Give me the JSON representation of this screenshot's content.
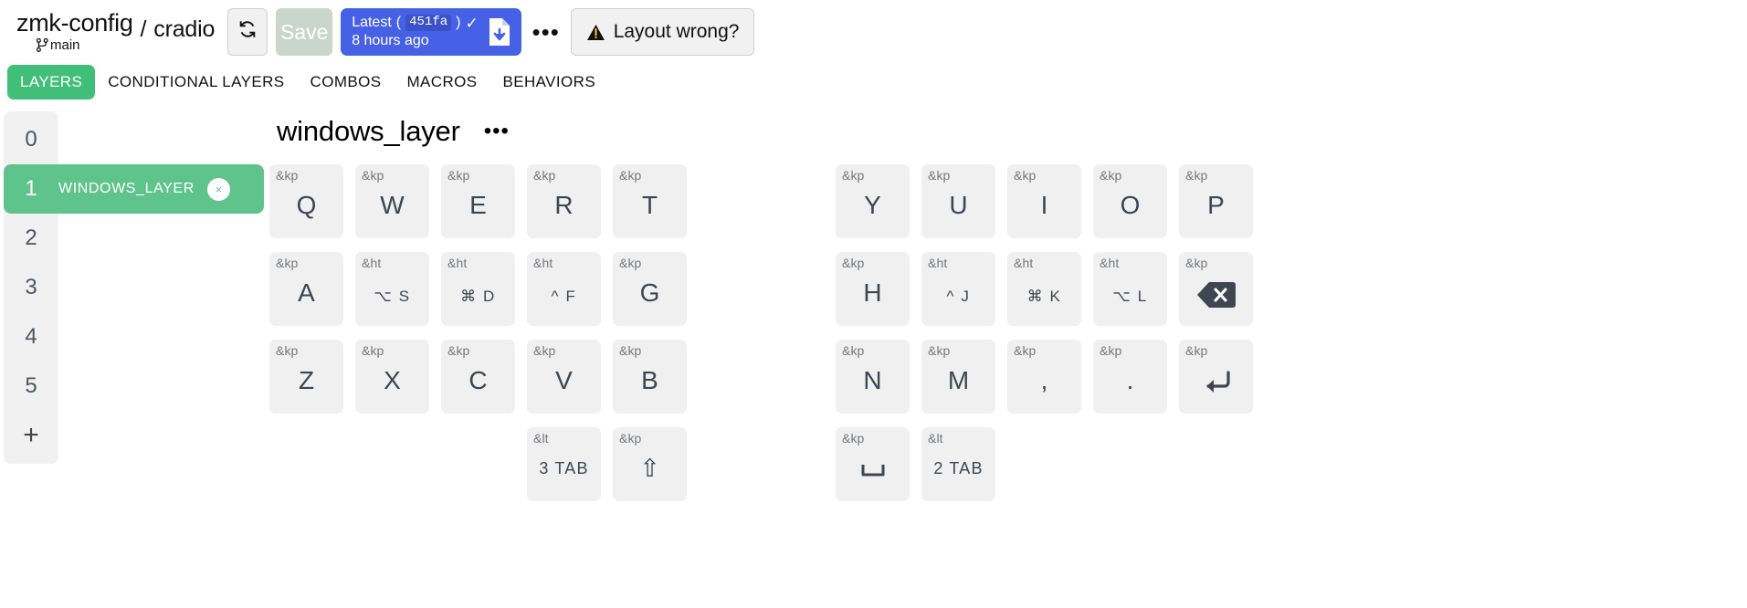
{
  "header": {
    "repo_name": "zmk-config",
    "branch": "main",
    "separator": "/",
    "keyboard": "cradio",
    "refresh_icon": "refresh-icon",
    "save_label": "Save",
    "commit": {
      "label": "Latest",
      "open_paren": "(",
      "sha": "451fa",
      "close_paren": ")",
      "check": "✓",
      "time": "8 hours ago",
      "download_icon": "file-download-icon",
      "color": "#4661e6"
    },
    "more_label": "•••",
    "layout_warning_label": "Layout wrong?",
    "layout_warning_icon": "warning-triangle-icon"
  },
  "tabs": [
    {
      "label": "LAYERS",
      "active": true
    },
    {
      "label": "CONDITIONAL LAYERS",
      "active": false
    },
    {
      "label": "COMBOS",
      "active": false
    },
    {
      "label": "MACROS",
      "active": false
    },
    {
      "label": "BEHAVIORS",
      "active": false
    }
  ],
  "tab_active_color": "#41bf78",
  "layers": {
    "items": [
      {
        "index": "0",
        "name": "",
        "selected": false
      },
      {
        "index": "1",
        "name": "WINDOWS_LAYER",
        "selected": true
      },
      {
        "index": "2",
        "name": "",
        "selected": false
      },
      {
        "index": "3",
        "name": "",
        "selected": false
      },
      {
        "index": "4",
        "name": "",
        "selected": false
      },
      {
        "index": "5",
        "name": "",
        "selected": false
      }
    ],
    "add_label": "+",
    "delete_label": "×",
    "selected_color": "#5ec48c"
  },
  "keymap": {
    "title": "windows_layer",
    "menu_label": "•••",
    "left": [
      {
        "behavior": "&kp",
        "cap": "Q",
        "style": "letter",
        "row": 0,
        "col": 0
      },
      {
        "behavior": "&kp",
        "cap": "W",
        "style": "letter",
        "row": 0,
        "col": 1
      },
      {
        "behavior": "&kp",
        "cap": "E",
        "style": "letter",
        "row": 0,
        "col": 2
      },
      {
        "behavior": "&kp",
        "cap": "R",
        "style": "letter",
        "row": 0,
        "col": 3
      },
      {
        "behavior": "&kp",
        "cap": "T",
        "style": "letter",
        "row": 0,
        "col": 4
      },
      {
        "behavior": "&kp",
        "cap": "A",
        "style": "letter",
        "row": 1,
        "col": 0
      },
      {
        "behavior": "&ht",
        "cap": "⌥ S",
        "style": "mod",
        "row": 1,
        "col": 1
      },
      {
        "behavior": "&ht",
        "cap": "⌘ D",
        "style": "mod",
        "row": 1,
        "col": 2
      },
      {
        "behavior": "&ht",
        "cap": "^ F",
        "style": "mod",
        "row": 1,
        "col": 3
      },
      {
        "behavior": "&kp",
        "cap": "G",
        "style": "letter",
        "row": 1,
        "col": 4
      },
      {
        "behavior": "&kp",
        "cap": "Z",
        "style": "letter",
        "row": 2,
        "col": 0
      },
      {
        "behavior": "&kp",
        "cap": "X",
        "style": "letter",
        "row": 2,
        "col": 1
      },
      {
        "behavior": "&kp",
        "cap": "C",
        "style": "letter",
        "row": 2,
        "col": 2
      },
      {
        "behavior": "&kp",
        "cap": "V",
        "style": "letter",
        "row": 2,
        "col": 3
      },
      {
        "behavior": "&kp",
        "cap": "B",
        "style": "letter",
        "row": 2,
        "col": 4
      },
      {
        "behavior": "&lt",
        "cap": "3 TAB",
        "style": "small",
        "row": 3,
        "col": 3
      },
      {
        "behavior": "&kp",
        "cap": "⇧",
        "style": "glyph",
        "row": 3,
        "col": 4
      }
    ],
    "right": [
      {
        "behavior": "&kp",
        "cap": "Y",
        "style": "letter",
        "row": 0,
        "col": 0
      },
      {
        "behavior": "&kp",
        "cap": "U",
        "style": "letter",
        "row": 0,
        "col": 1
      },
      {
        "behavior": "&kp",
        "cap": "I",
        "style": "letter",
        "row": 0,
        "col": 2
      },
      {
        "behavior": "&kp",
        "cap": "O",
        "style": "letter",
        "row": 0,
        "col": 3
      },
      {
        "behavior": "&kp",
        "cap": "P",
        "style": "letter",
        "row": 0,
        "col": 4
      },
      {
        "behavior": "&kp",
        "cap": "H",
        "style": "letter",
        "row": 1,
        "col": 0
      },
      {
        "behavior": "&ht",
        "cap": "^ J",
        "style": "mod",
        "row": 1,
        "col": 1
      },
      {
        "behavior": "&ht",
        "cap": "⌘ K",
        "style": "mod",
        "row": 1,
        "col": 2
      },
      {
        "behavior": "&ht",
        "cap": "⌥ L",
        "style": "mod",
        "row": 1,
        "col": 3
      },
      {
        "behavior": "&kp",
        "cap": "",
        "style": "icon",
        "icon": "backspace-icon",
        "row": 1,
        "col": 4
      },
      {
        "behavior": "&kp",
        "cap": "N",
        "style": "letter",
        "row": 2,
        "col": 0
      },
      {
        "behavior": "&kp",
        "cap": "M",
        "style": "letter",
        "row": 2,
        "col": 1
      },
      {
        "behavior": "&kp",
        "cap": ",",
        "style": "letter",
        "row": 2,
        "col": 2
      },
      {
        "behavior": "&kp",
        "cap": ".",
        "style": "letter",
        "row": 2,
        "col": 3
      },
      {
        "behavior": "&kp",
        "cap": "",
        "style": "icon",
        "icon": "enter-icon",
        "row": 2,
        "col": 4
      },
      {
        "behavior": "&kp",
        "cap": "",
        "style": "icon",
        "icon": "space-icon",
        "row": 3,
        "col": 0
      },
      {
        "behavior": "&lt",
        "cap": "2 TAB",
        "style": "small",
        "row": 3,
        "col": 1
      }
    ]
  }
}
